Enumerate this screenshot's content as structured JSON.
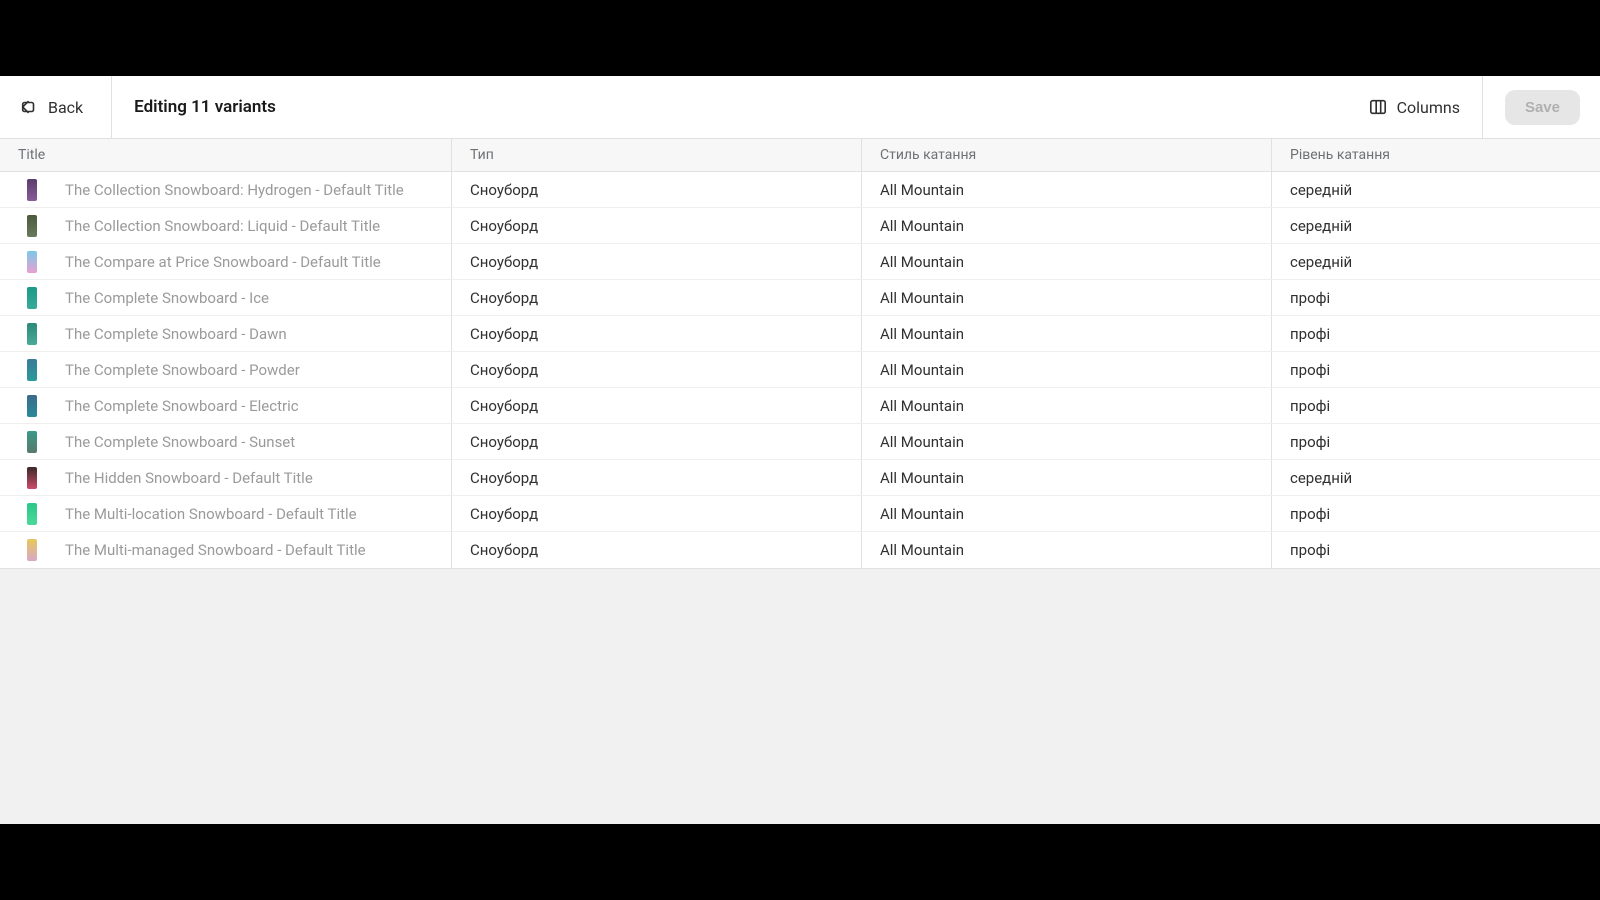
{
  "header": {
    "back_label": "Back",
    "page_title": "Editing 11 variants",
    "columns_label": "Columns",
    "save_label": "Save"
  },
  "columns": {
    "title": "Title",
    "type": "Тип",
    "style": "Стиль катання",
    "level": "Рівень катання"
  },
  "rows": [
    {
      "title": "The Collection Snowboard: Hydrogen - Default Title",
      "type": "Сноуборд",
      "style": "All Mountain",
      "level": "середній"
    },
    {
      "title": "The Collection Snowboard: Liquid - Default Title",
      "type": "Сноуборд",
      "style": "All Mountain",
      "level": "середній"
    },
    {
      "title": "The Compare at Price Snowboard - Default Title",
      "type": "Сноуборд",
      "style": "All Mountain",
      "level": "середній"
    },
    {
      "title": "The Complete Snowboard - Ice",
      "type": "Сноуборд",
      "style": "All Mountain",
      "level": "профі"
    },
    {
      "title": "The Complete Snowboard - Dawn",
      "type": "Сноуборд",
      "style": "All Mountain",
      "level": "профі"
    },
    {
      "title": "The Complete Snowboard - Powder",
      "type": "Сноуборд",
      "style": "All Mountain",
      "level": "профі"
    },
    {
      "title": "The Complete Snowboard - Electric",
      "type": "Сноуборд",
      "style": "All Mountain",
      "level": "профі"
    },
    {
      "title": "The Complete Snowboard - Sunset",
      "type": "Сноуборд",
      "style": "All Mountain",
      "level": "профі"
    },
    {
      "title": "The Hidden Snowboard - Default Title",
      "type": "Сноуборд",
      "style": "All Mountain",
      "level": "середній"
    },
    {
      "title": "The Multi-location Snowboard - Default Title",
      "type": "Сноуборд",
      "style": "All Mountain",
      "level": "профі"
    },
    {
      "title": "The Multi-managed Snowboard - Default Title",
      "type": "Сноуборд",
      "style": "All Mountain",
      "level": "профі"
    }
  ]
}
